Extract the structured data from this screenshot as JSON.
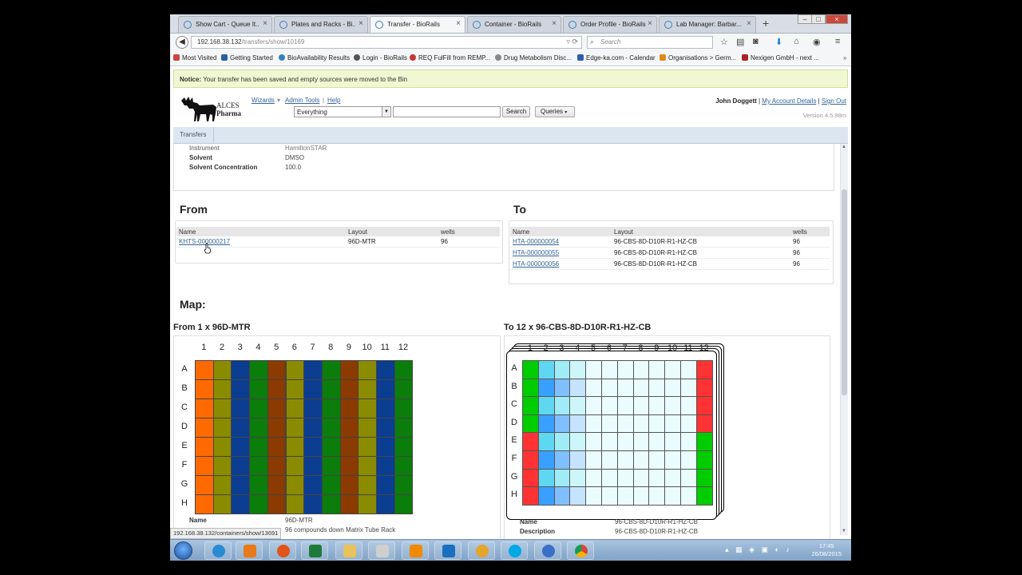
{
  "browser": {
    "tabs": [
      {
        "label": "Show Cart - Queue It...",
        "active": false
      },
      {
        "label": "Plates and Racks - Bi...",
        "active": false
      },
      {
        "label": "Transfer - BioRails",
        "active": true
      },
      {
        "label": "Container - BioRails",
        "active": false
      },
      {
        "label": "Order Profile - BioRails",
        "active": false
      },
      {
        "label": "Lab Manager: Barbar...",
        "active": false
      }
    ],
    "url_host": "192.168.38.132",
    "url_path": "/transfers/show/10169",
    "search_placeholder": "Search",
    "bookmarks": [
      "Most Visited",
      "Getting Started",
      "BioAvailability Results",
      "Login - BioRails",
      "REQ FulFill from REMP...",
      "Drug Metabolism Disc...",
      "Edge-ka.com - Calendar",
      "Organisations > Germ...",
      "Nexigen GmbH - next ..."
    ],
    "status_url": "192.168.38.132/containers/show/13691"
  },
  "notice": {
    "label": "Notice:",
    "message": "Your transfer has been saved and empty sources were moved to the Bin"
  },
  "header": {
    "logo_line1": "ALCES",
    "logo_line2": "Pharma",
    "menu": [
      "Wizards",
      "Admin Tools",
      "Help"
    ],
    "query_scope": "Everything",
    "search_button": "Search",
    "queries_button": "Queries",
    "user_name": "John Doggett",
    "account_link": "My Account Details",
    "signout_link": "Sign Out",
    "version": "Version 4.5.98m"
  },
  "subnav": {
    "tab": "Transfers"
  },
  "details": [
    {
      "key": "Instrument",
      "value": "HamiltonSTAR"
    },
    {
      "key": "Solvent",
      "value": "DMSO"
    },
    {
      "key": "Solvent Concentration",
      "value": "100.0"
    }
  ],
  "from": {
    "title": "From",
    "columns": [
      "Name",
      "Layout",
      "wells"
    ],
    "rows": [
      {
        "name": "KHTS-000000217",
        "layout": "96D-MTR",
        "wells": "96"
      }
    ]
  },
  "to": {
    "title": "To",
    "columns": [
      "Name",
      "Layout",
      "wells"
    ],
    "rows": [
      {
        "name": "HTA-000000054",
        "layout": "96-CBS-8D-D10R-R1-HZ-CB",
        "wells": "96"
      },
      {
        "name": "HTA-000000055",
        "layout": "96-CBS-8D-D10R-R1-HZ-CB",
        "wells": "96"
      },
      {
        "name": "HTA-000000056",
        "layout": "96-CBS-8D-D10R-R1-HZ-CB",
        "wells": "96"
      }
    ]
  },
  "map": {
    "title": "Map:",
    "from_title": "From 1 x 96D-MTR",
    "to_title": "To 12 x 96-CBS-8D-D10R-R1-HZ-CB",
    "columns": [
      "1",
      "2",
      "3",
      "4",
      "5",
      "6",
      "7",
      "8",
      "9",
      "10",
      "11",
      "12"
    ],
    "rows": [
      "A",
      "B",
      "C",
      "D",
      "E",
      "F",
      "G",
      "H"
    ],
    "from_column_colors": [
      "#ff6a00",
      "#8b8b00",
      "#0b3d91",
      "#0b7d0b",
      "#8b3a00",
      "#8b8b00",
      "#0b3d91",
      "#0b7d0b",
      "#8b3a00",
      "#8b8b00",
      "#0b3d91",
      "#0b7d0b"
    ],
    "from_info": [
      {
        "key": "Name",
        "value": "96D-MTR"
      },
      {
        "key": "",
        "value": "96 compounds down Matrix Tube Rack"
      }
    ],
    "to_info": [
      {
        "key": "Name",
        "value": "96-CBS-8D-D10R-R1-HZ-CB"
      },
      {
        "key": "Description",
        "value": "96-CBS-8D-D10R-R1-HZ-CB"
      }
    ],
    "to_col1_colors": [
      "#00cc00",
      "#00cc00",
      "#00cc00",
      "#00cc00",
      "#ff3333",
      "#ff3333",
      "#ff3333",
      "#ff3333"
    ],
    "to_col12_colors": [
      "#ff3333",
      "#ff3333",
      "#ff3333",
      "#ff3333",
      "#00cc00",
      "#00cc00",
      "#00cc00",
      "#00cc00"
    ],
    "to_col2_colors": [
      "#5fd7f0",
      "#3aa0ff",
      "#5fd7f0",
      "#3aa0ff",
      "#5fd7f0",
      "#3aa0ff",
      "#5fd7f0",
      "#3aa0ff"
    ],
    "to_col3_colors": [
      "#9fecf7",
      "#7fbfff",
      "#9fecf7",
      "#7fbfff",
      "#9fecf7",
      "#7fbfff",
      "#9fecf7",
      "#7fbfff"
    ],
    "to_col4_colors": [
      "#cdf6fb",
      "#c5e3ff",
      "#cdf6fb",
      "#c5e3ff",
      "#cdf6fb",
      "#c5e3ff",
      "#cdf6fb",
      "#c5e3ff"
    ],
    "to_mid_color": "#eafcfe"
  },
  "taskbar": {
    "time": "17:45",
    "date": "26/08/2015"
  }
}
